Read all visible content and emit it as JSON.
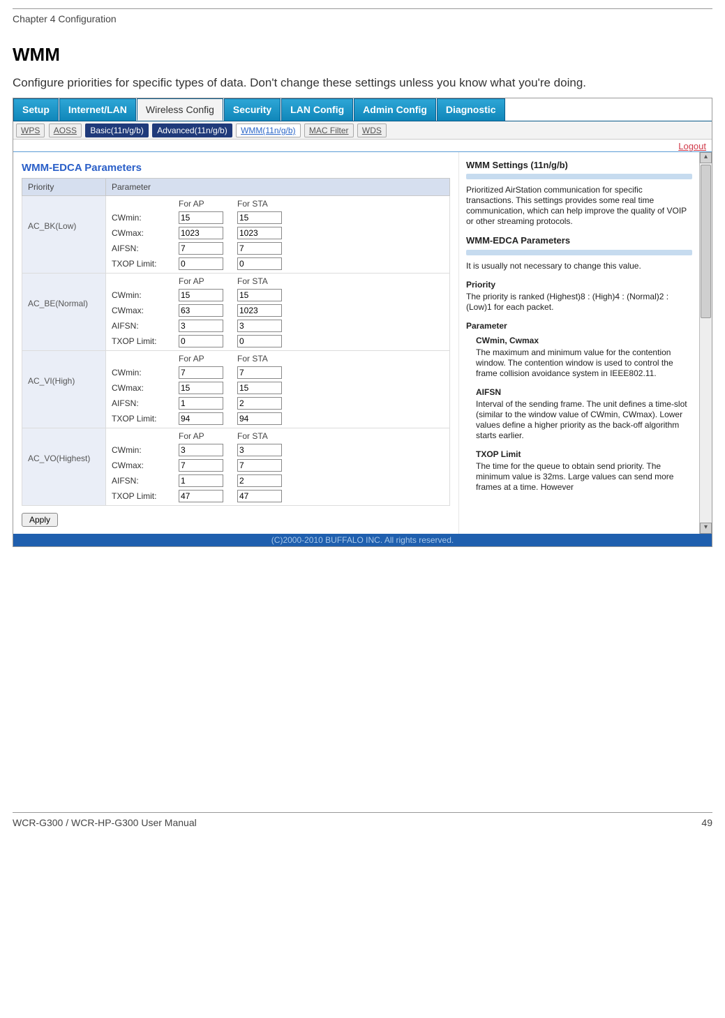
{
  "chapter": "Chapter 4  Configuration",
  "section_title": "WMM",
  "section_desc": "Configure priorities for specific types of data.  Don't change these settings unless you know what you're doing.",
  "tabs": {
    "setup": "Setup",
    "internet": "Internet/LAN",
    "wireless": "Wireless Config",
    "security": "Security",
    "lan": "LAN Config",
    "admin": "Admin Config",
    "diag": "Diagnostic"
  },
  "subtabs": {
    "wps": "WPS",
    "aoss": "AOSS",
    "basic": "Basic(11n/g/b)",
    "advanced": "Advanced(11n/g/b)",
    "wmm": "WMM(11n/g/b)",
    "mac": "MAC Filter",
    "wds": "WDS"
  },
  "logout": "Logout",
  "panel_title": "WMM-EDCA Parameters",
  "th_priority": "Priority",
  "th_parameter": "Parameter",
  "col_for_ap": "For AP",
  "col_for_sta": "For STA",
  "lbl_cwmin": "CWmin:",
  "lbl_cwmax": "CWmax:",
  "lbl_aifsn": "AIFSN:",
  "lbl_txop": "TXOP Limit:",
  "rows": [
    {
      "prio": "AC_BK(Low)",
      "ap": [
        "15",
        "1023",
        "7",
        "0"
      ],
      "sta": [
        "15",
        "1023",
        "7",
        "0"
      ]
    },
    {
      "prio": "AC_BE(Normal)",
      "ap": [
        "15",
        "63",
        "3",
        "0"
      ],
      "sta": [
        "15",
        "1023",
        "3",
        "0"
      ]
    },
    {
      "prio": "AC_VI(High)",
      "ap": [
        "7",
        "15",
        "1",
        "94"
      ],
      "sta": [
        "7",
        "15",
        "2",
        "94"
      ]
    },
    {
      "prio": "AC_VO(Highest)",
      "ap": [
        "3",
        "7",
        "1",
        "47"
      ],
      "sta": [
        "3",
        "7",
        "2",
        "47"
      ]
    }
  ],
  "apply": "Apply",
  "help": {
    "h_settings": "WMM Settings (11n/g/b)",
    "p_settings": "Prioritized AirStation communication for specific transactions. This settings provides some real time communication, which can help improve the quality of VOIP or other streaming protocols.",
    "h_edca": "WMM-EDCA Parameters",
    "p_edca": "It is usually not necessary to change this value.",
    "h_priority": "Priority",
    "p_priority": "The priority is ranked (Highest)8 : (High)4 : (Normal)2 : (Low)1 for each packet.",
    "h_param": "Parameter",
    "h_cw": "CWmin, Cwmax",
    "p_cw": "The maximum and minimum value for the contention window. The contention window is used to control the frame collision avoidance system in IEEE802.11.",
    "h_aifsn": "AIFSN",
    "p_aifsn": "Interval of the sending frame. The unit defines a time-slot (similar to the window value of CWmin, CWmax). Lower values define a higher priority as the back-off algorithm starts earlier.",
    "h_txop": "TXOP Limit",
    "p_txop": "The time for the queue to obtain send priority. The minimum value is 32ms. Large values can send more frames at a time. However"
  },
  "copyright": "(C)2000-2010 BUFFALO INC. All rights reserved.",
  "footer_left": "WCR-G300 / WCR-HP-G300 User Manual",
  "footer_right": "49"
}
